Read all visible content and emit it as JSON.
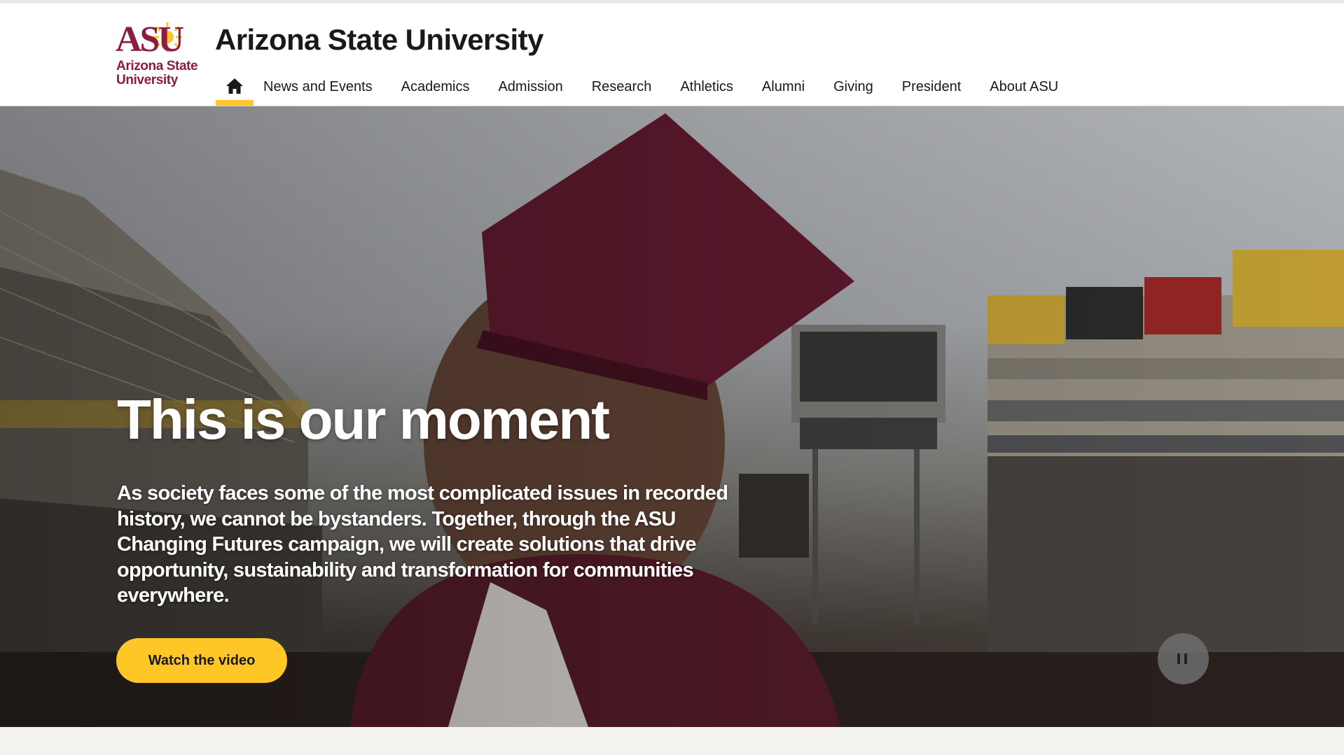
{
  "brand": {
    "logo_mark": "ASU",
    "logo_name_line1": "Arizona State",
    "logo_name_line2": "University",
    "site_title": "Arizona State University",
    "maroon": "#8c1d40",
    "gold": "#ffc627"
  },
  "nav": {
    "home_icon": "home-icon",
    "items": [
      {
        "label": "News and Events"
      },
      {
        "label": "Academics"
      },
      {
        "label": "Admission"
      },
      {
        "label": "Research"
      },
      {
        "label": "Athletics"
      },
      {
        "label": "Alumni"
      },
      {
        "label": "Giving"
      },
      {
        "label": "President"
      },
      {
        "label": "About ASU"
      }
    ]
  },
  "hero": {
    "title": "This is our moment",
    "text": "As society faces some of the most complicated issues in recorded history, we cannot be bystanders. Together, through the ASU Changing Futures campaign, we will create solutions that drive opportunity, sustainability and transformation for communities everywhere.",
    "cta_label": "Watch the video",
    "pause_icon": "pause-icon"
  }
}
